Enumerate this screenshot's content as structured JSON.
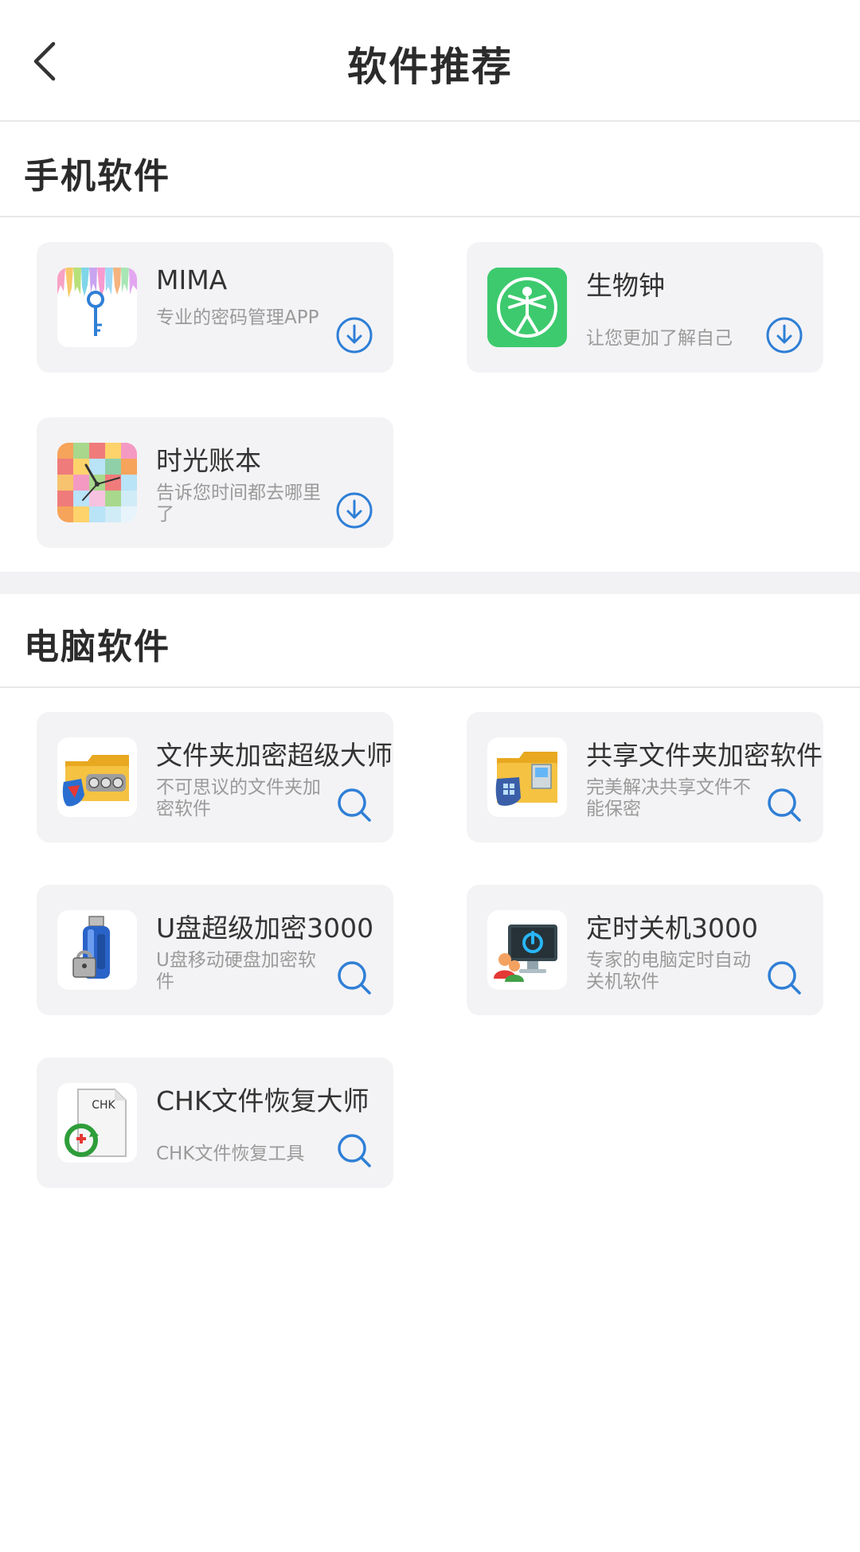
{
  "header": {
    "title": "软件推荐"
  },
  "mobile": {
    "title": "手机软件",
    "items": [
      {
        "name": "MIMA",
        "desc": "专业的密码管理APP"
      },
      {
        "name": "生物钟",
        "desc": "让您更加了解自己"
      },
      {
        "name": "时光账本",
        "desc": "告诉您时间都去哪里了"
      }
    ]
  },
  "pc": {
    "title": "电脑软件",
    "items": [
      {
        "name": "文件夹加密超级大师",
        "desc": "不可思议的文件夹加密软件"
      },
      {
        "name": "共享文件夹加密软件",
        "desc": "完美解决共享文件不能保密"
      },
      {
        "name": "U盘超级加密3000",
        "desc": "U盘移动硬盘加密软件"
      },
      {
        "name": "定时关机3000",
        "desc": "专家的电脑定时自动关机软件"
      },
      {
        "name": "CHK文件恢复大师",
        "desc": "CHK文件恢复工具",
        "icon_text": "CHK"
      }
    ]
  },
  "icons": {
    "back": "chevron-left-icon",
    "download": "download-circle-icon",
    "search": "search-icon"
  },
  "colors": {
    "accent": "#2f7fd6",
    "card_bg": "#f3f3f5",
    "divider": "#e8e8e8",
    "green_app": "#3dca6e"
  }
}
